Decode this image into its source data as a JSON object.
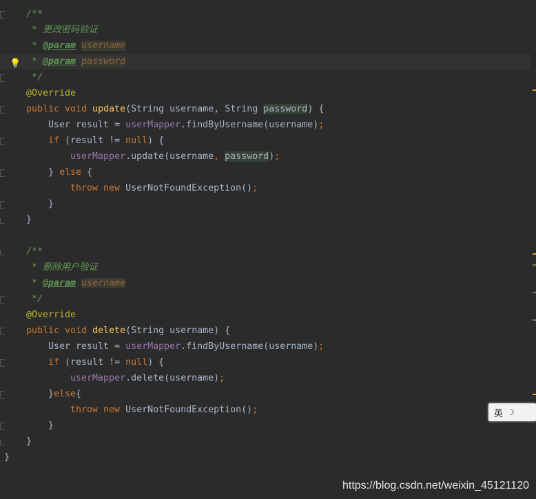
{
  "colors": {
    "background": "#2b2b2b",
    "default_text": "#a9b7c6",
    "keyword": "#cc7832",
    "annotation": "#bbb529",
    "method": "#ffc66d",
    "field": "#9876aa",
    "comment": "#629755"
  },
  "code": {
    "lines": [
      {
        "i": 0,
        "t": [
          {
            "c": "cm",
            "v": "/**"
          }
        ]
      },
      {
        "i": 0,
        "t": [
          {
            "c": "cm",
            "v": " * 更改密码验证"
          }
        ]
      },
      {
        "i": 0,
        "t": [
          {
            "c": "cm",
            "v": " * "
          },
          {
            "c": "cmtag",
            "v": "@param"
          },
          {
            "c": "cm",
            "v": " "
          },
          {
            "c": "parref",
            "v": "username"
          }
        ]
      },
      {
        "i": 0,
        "current": true,
        "bulb": true,
        "t": [
          {
            "c": "cm",
            "v": " * "
          },
          {
            "c": "cmtag",
            "v": "@param"
          },
          {
            "c": "cm",
            "v": " "
          },
          {
            "c": "parref",
            "v": "password"
          }
        ]
      },
      {
        "i": 0,
        "t": [
          {
            "c": "cm",
            "v": " */"
          }
        ]
      },
      {
        "i": 0,
        "t": [
          {
            "c": "ann",
            "v": "@Override"
          }
        ]
      },
      {
        "i": 0,
        "t": [
          {
            "c": "kw",
            "v": "public void "
          },
          {
            "c": "fn",
            "v": "update"
          },
          {
            "c": "",
            "v": "(String username, String "
          },
          {
            "c": "hl",
            "v": "password"
          },
          {
            "c": "",
            "v": ") {"
          }
        ]
      },
      {
        "i": 1,
        "t": [
          {
            "c": "",
            "v": "User result = "
          },
          {
            "c": "fld",
            "v": "userMapper"
          },
          {
            "c": "",
            "v": ".findByUsername(username)"
          },
          {
            "c": "kw",
            "v": ";"
          }
        ]
      },
      {
        "i": 1,
        "t": [
          {
            "c": "kw",
            "v": "if "
          },
          {
            "c": "",
            "v": "(result != "
          },
          {
            "c": "kw",
            "v": "null"
          },
          {
            "c": "",
            "v": ") {"
          }
        ]
      },
      {
        "i": 2,
        "t": [
          {
            "c": "fld",
            "v": "userMapper"
          },
          {
            "c": "",
            "v": ".update(username"
          },
          {
            "c": "kw",
            "v": ", "
          },
          {
            "c": "hl",
            "v": "password"
          },
          {
            "c": "",
            "v": ")"
          },
          {
            "c": "kw",
            "v": ";"
          }
        ]
      },
      {
        "i": 1,
        "t": [
          {
            "c": "",
            "v": "} "
          },
          {
            "c": "kw",
            "v": "else "
          },
          {
            "c": "",
            "v": "{"
          }
        ]
      },
      {
        "i": 2,
        "t": [
          {
            "c": "kw",
            "v": "throw new "
          },
          {
            "c": "",
            "v": "UserNotFoundException()"
          },
          {
            "c": "kw",
            "v": ";"
          }
        ]
      },
      {
        "i": 1,
        "t": [
          {
            "c": "",
            "v": "}"
          }
        ]
      },
      {
        "i": 0,
        "t": [
          {
            "c": "",
            "v": "}"
          }
        ]
      },
      {
        "i": 0,
        "t": []
      },
      {
        "i": 0,
        "t": [
          {
            "c": "cm",
            "v": "/**"
          }
        ]
      },
      {
        "i": 0,
        "t": [
          {
            "c": "cm",
            "v": " * 删除用户验证"
          }
        ]
      },
      {
        "i": 0,
        "t": [
          {
            "c": "cm",
            "v": " * "
          },
          {
            "c": "cmtag",
            "v": "@param"
          },
          {
            "c": "cm",
            "v": " "
          },
          {
            "c": "parref",
            "v": "username"
          }
        ]
      },
      {
        "i": 0,
        "t": [
          {
            "c": "cm",
            "v": " */"
          }
        ]
      },
      {
        "i": 0,
        "t": [
          {
            "c": "ann",
            "v": "@Override"
          }
        ]
      },
      {
        "i": 0,
        "t": [
          {
            "c": "kw",
            "v": "public void "
          },
          {
            "c": "fn",
            "v": "delete"
          },
          {
            "c": "",
            "v": "(String username) {"
          }
        ]
      },
      {
        "i": 1,
        "t": [
          {
            "c": "",
            "v": "User result = "
          },
          {
            "c": "fld",
            "v": "userMapper"
          },
          {
            "c": "",
            "v": ".findByUsername(username)"
          },
          {
            "c": "kw",
            "v": ";"
          }
        ]
      },
      {
        "i": 1,
        "t": [
          {
            "c": "kw",
            "v": "if "
          },
          {
            "c": "",
            "v": "(result != "
          },
          {
            "c": "kw",
            "v": "null"
          },
          {
            "c": "",
            "v": ") {"
          }
        ]
      },
      {
        "i": 2,
        "t": [
          {
            "c": "fld",
            "v": "userMapper"
          },
          {
            "c": "",
            "v": ".delete(username)"
          },
          {
            "c": "kw",
            "v": ";"
          }
        ]
      },
      {
        "i": 1,
        "t": [
          {
            "c": "",
            "v": "}"
          },
          {
            "c": "kw",
            "v": "else"
          },
          {
            "c": "",
            "v": "{"
          }
        ]
      },
      {
        "i": 2,
        "t": [
          {
            "c": "kw",
            "v": "throw new "
          },
          {
            "c": "",
            "v": "UserNotFoundException()"
          },
          {
            "c": "kw",
            "v": ";"
          }
        ]
      },
      {
        "i": 1,
        "t": [
          {
            "c": "",
            "v": "}"
          }
        ]
      },
      {
        "i": 0,
        "t": [
          {
            "c": "",
            "v": "}"
          }
        ]
      },
      {
        "i": -1,
        "t": [
          {
            "c": "",
            "v": "}"
          }
        ]
      }
    ]
  },
  "ime": {
    "lang": "英",
    "icon": "moon-icon",
    "mode": " "
  },
  "watermark": "https://blog.csdn.net/weixin_45121120"
}
